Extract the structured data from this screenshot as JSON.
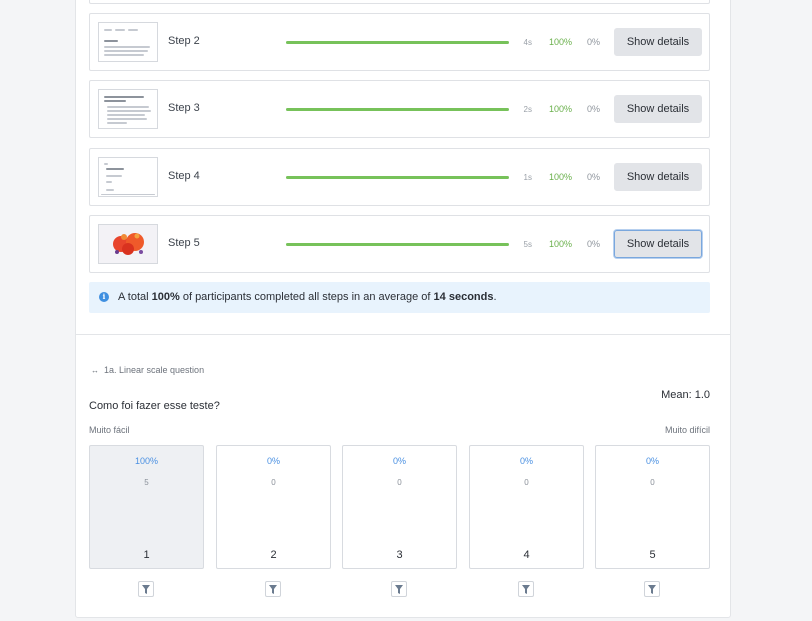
{
  "steps": [
    {
      "label": "Step 2",
      "time": "4s",
      "completed_pct": "100%",
      "failed_pct": "0%",
      "progress": 1.0,
      "button": "Show details"
    },
    {
      "label": "Step 3",
      "time": "2s",
      "completed_pct": "100%",
      "failed_pct": "0%",
      "progress": 1.0,
      "button": "Show details"
    },
    {
      "label": "Step 4",
      "time": "1s",
      "completed_pct": "100%",
      "failed_pct": "0%",
      "progress": 1.0,
      "button": "Show details"
    },
    {
      "label": "Step 5",
      "time": "5s",
      "completed_pct": "100%",
      "failed_pct": "0%",
      "progress": 1.0,
      "button": "Show details"
    }
  ],
  "summary": {
    "prefix": "A total ",
    "total": "100%",
    "middle": " of participants completed all steps in an average of ",
    "avg": "14 seconds",
    "suffix": "."
  },
  "question": {
    "type_label": "1a. Linear scale question",
    "title": "Como foi fazer esse teste?",
    "mean": "Mean: 1.0",
    "scale_left": "Muito fácil",
    "scale_right": "Muito difícil",
    "options": [
      {
        "pct": "100%",
        "count": "5",
        "value": "1"
      },
      {
        "pct": "0%",
        "count": "0",
        "value": "2"
      },
      {
        "pct": "0%",
        "count": "0",
        "value": "3"
      },
      {
        "pct": "0%",
        "count": "0",
        "value": "4"
      },
      {
        "pct": "0%",
        "count": "0",
        "value": "5"
      }
    ]
  },
  "icons": {
    "info": "info-icon",
    "arrows": "arrows-horizontal-icon",
    "filter": "filter-icon"
  },
  "colors": {
    "progress": "#77c25a",
    "completed_text": "#6ab04c",
    "percent_text": "#4a90e2",
    "info_bg": "#e8f3fd"
  }
}
